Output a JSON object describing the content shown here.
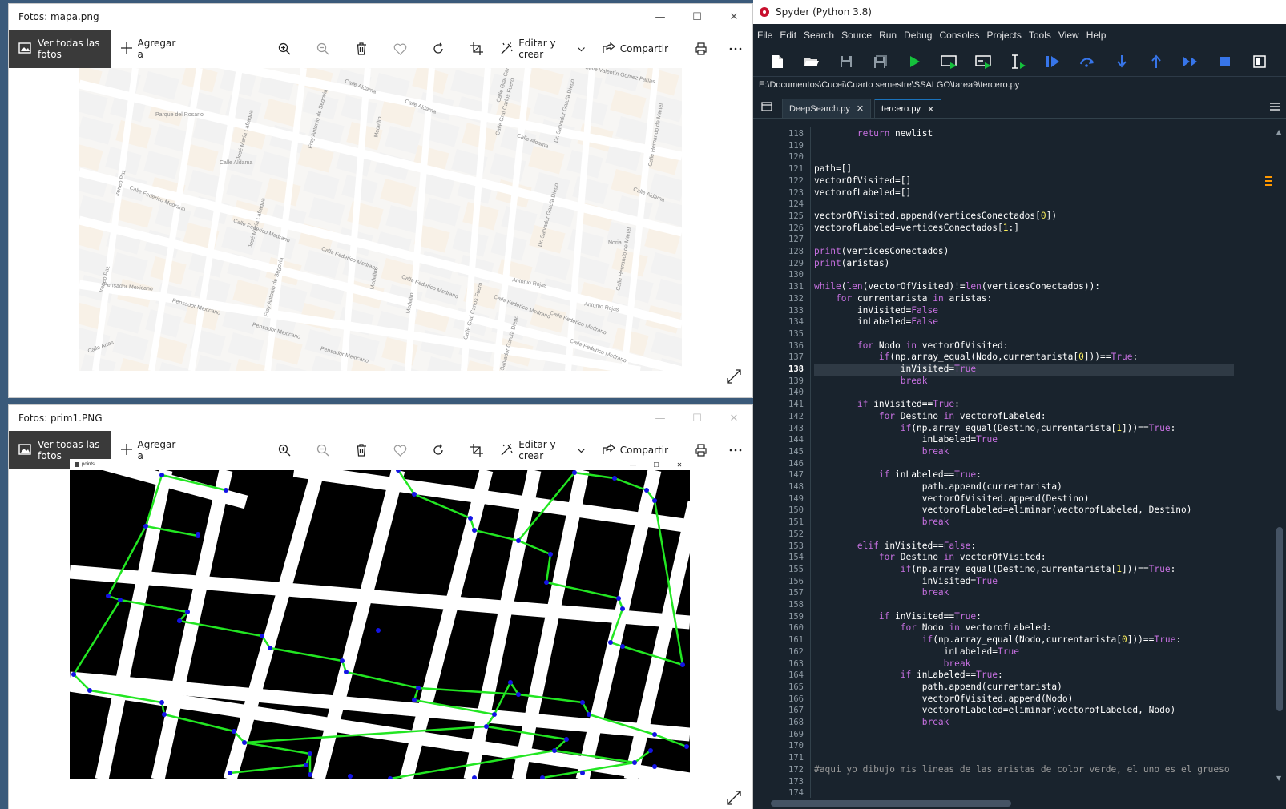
{
  "photos_top": {
    "title": "Fotos: mapa.png",
    "toolbar": {
      "all_photos": "Ver todas las fotos",
      "add_to": "Agregar a",
      "edit_create": "Editar y crear",
      "share": "Compartir"
    },
    "map_labels": [
      "Calle Valentín Gómez Farías",
      "Calle Aldama",
      "Calle Aldama",
      "Calle Aldama",
      "Calle Aldama",
      "Calle Aldama",
      "Parque del Rosario",
      "José María Lafragua",
      "José María Lafragua",
      "Fray Antonio de Segovia",
      "Fray Antonio de Segovia",
      "Medellín",
      "Medellín",
      "Medellín",
      "Calle Gral Carlos Fuero",
      "Calle Gral Carlos Fuero",
      "Dr. Salvador García Diego",
      "Dr. Salvador García Diego",
      "Dr. Salvador García Diego",
      "Calle Hernando de Martel",
      "Calle Hernando de Martel",
      "Calle Federico Medrano",
      "Calle Federico Medrano",
      "Calle Federico Medrano",
      "Calle Federico Medrano",
      "Calle Federico Medrano",
      "Calle Federico Medrano",
      "Calle Federico Medrano",
      "Ireneo Paz",
      "Ireneo Paz",
      "Pensador Mexicano",
      "Pensador Mexicano",
      "Pensador Mexicano",
      "Pensador Mexicano",
      "Antonio Rojas",
      "Antonio Rojas",
      "Noria",
      "Calle Gral Cano",
      "Calle Artes"
    ]
  },
  "photos_bottom": {
    "title": "Fotos: prim1.PNG",
    "toolbar": {
      "all_photos": "Ver todas las fotos",
      "add_to": "Agregar a",
      "edit_create": "Editar y crear",
      "share": "Compartir"
    },
    "inner_window_title": "points"
  },
  "spyder": {
    "title": "Spyder (Python 3.8)",
    "menu": [
      "File",
      "Edit",
      "Search",
      "Source",
      "Run",
      "Debug",
      "Consoles",
      "Projects",
      "Tools",
      "View",
      "Help"
    ],
    "path": "E:\\Documentos\\Cucei\\Cuarto semestre\\SSALGO\\tarea9\\tercero.py",
    "tabs": [
      {
        "label": "DeepSearch.py",
        "active": false
      },
      {
        "label": "tercero.py",
        "active": true
      }
    ],
    "current_line": 138,
    "first_line": 118,
    "code_lines": [
      "        return newlist",
      "",
      "",
      "path=[]",
      "vectorOfVisited=[]",
      "vectorofLabeled=[]",
      "",
      "vectorOfVisited.append(verticesConectados[0])",
      "vectorofLabeled=verticesConectados[1:]",
      "",
      "print(verticesConectados)",
      "print(aristas)",
      "",
      "while(len(vectorOfVisited)!=len(verticesConectados)):",
      "    for currentarista in aristas:",
      "        inVisited=False",
      "        inLabeled=False",
      "",
      "        for Nodo in vectorOfVisited:",
      "            if(np.array_equal(Nodo,currentarista[0]))==True:",
      "                inVisited=True",
      "                break",
      "",
      "        if inVisited==True:",
      "            for Destino in vectorofLabeled:",
      "                if(np.array_equal(Destino,currentarista[1]))==True:",
      "                    inLabeled=True",
      "                    break",
      "",
      "            if inLabeled==True:",
      "                    path.append(currentarista)",
      "                    vectorOfVisited.append(Destino)",
      "                    vectorofLabeled=eliminar(vectorofLabeled, Destino)",
      "                    break",
      "",
      "        elif inVisited==False:",
      "            for Destino in vectorOfVisited:",
      "                if(np.array_equal(Destino,currentarista[1]))==True:",
      "                    inVisited=True",
      "                    break",
      "",
      "            if inVisited==True:",
      "                for Nodo in vectorofLabeled:",
      "                    if(np.array_equal(Nodo,currentarista[0]))==True:",
      "                        inLabeled=True",
      "                        break",
      "                if inLabeled==True:",
      "                    path.append(currentarista)",
      "                    vectorOfVisited.append(Nodo)",
      "                    vectorofLabeled=eliminar(vectorofLabeled, Nodo)",
      "                    break",
      "",
      "",
      "",
      "#aqui yo dibujo mis lineas de las aristas de color verde, el uno es el grueso"
    ]
  }
}
